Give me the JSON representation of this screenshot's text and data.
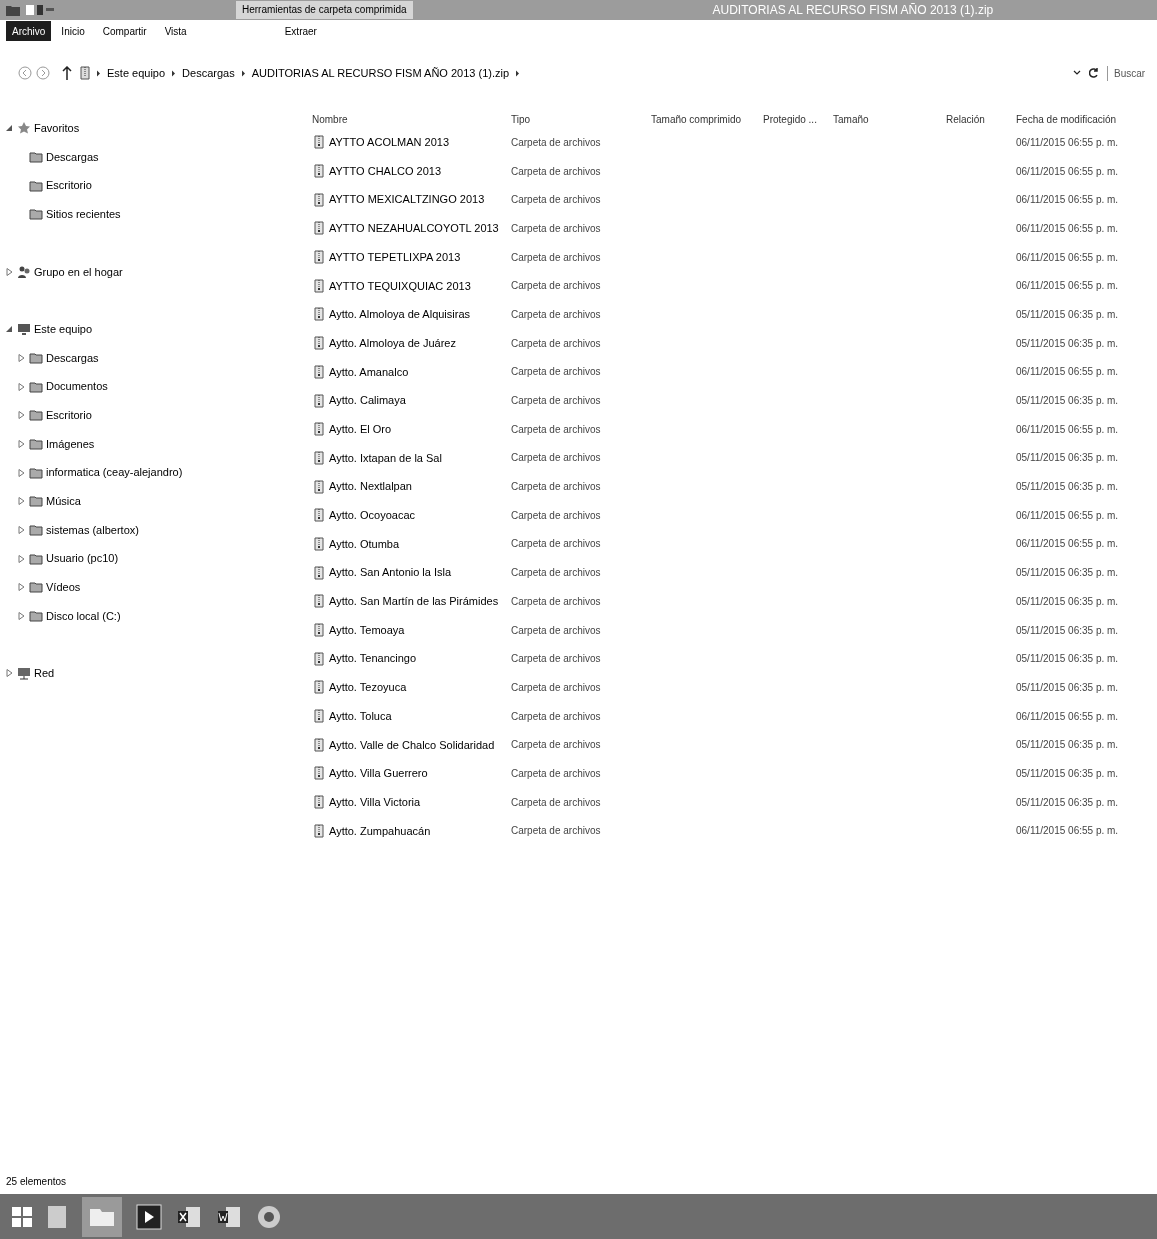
{
  "window": {
    "title": "AUDITORIAS AL RECURSO FISM AÑO 2013 (1).zip",
    "context_tab": "Herramientas de carpeta comprimida"
  },
  "ribbon_tabs": [
    {
      "label": "Archivo",
      "selected": true
    },
    {
      "label": "Inicio",
      "selected": false
    },
    {
      "label": "Compartir",
      "selected": false
    },
    {
      "label": "Vista",
      "selected": false
    },
    {
      "label": "Extraer",
      "selected": false
    }
  ],
  "address_bar": {
    "breadcrumbs": [
      "Este equipo",
      "Descargas",
      "AUDITORIAS AL RECURSO FISM AÑO 2013 (1).zip"
    ],
    "search_placeholder": "Buscar"
  },
  "sidebar": {
    "items": [
      {
        "label": "Favoritos",
        "expanded": true,
        "children": [
          {
            "label": "Descargas"
          },
          {
            "label": "Escritorio"
          },
          {
            "label": "Sitios recientes"
          }
        ]
      },
      {
        "label": "Grupo en el hogar",
        "expanded": false
      },
      {
        "label": "Este equipo",
        "expanded": true,
        "children": [
          {
            "label": "Descargas",
            "expanded": false
          },
          {
            "label": "Documentos",
            "expanded": false
          },
          {
            "label": "Escritorio",
            "expanded": false
          },
          {
            "label": "Imágenes",
            "expanded": false
          },
          {
            "label": "informatica (ceay-alejandro)",
            "expanded": false
          },
          {
            "label": "Música",
            "expanded": false
          },
          {
            "label": "sistemas (albertox)",
            "expanded": false
          },
          {
            "label": "Usuario (pc10)",
            "expanded": false
          },
          {
            "label": "Vídeos",
            "expanded": false
          },
          {
            "label": "Disco local (C:)",
            "expanded": false
          }
        ]
      },
      {
        "label": "Red",
        "expanded": false
      }
    ]
  },
  "table": {
    "columns": [
      "Nombre",
      "Tipo",
      "Tamaño comprimido",
      "Protegido ...",
      "Tamaño",
      "Relación",
      "Fecha de modificación"
    ],
    "rows": [
      {
        "name": "AYTTO ACOLMAN 2013",
        "type": "Carpeta de archivos",
        "modified": "06/11/2015 06:55 p. m."
      },
      {
        "name": "AYTTO CHALCO 2013",
        "type": "Carpeta de archivos",
        "modified": "06/11/2015 06:55 p. m."
      },
      {
        "name": "AYTTO MEXICALTZINGO 2013",
        "type": "Carpeta de archivos",
        "modified": "06/11/2015 06:55 p. m."
      },
      {
        "name": "AYTTO NEZAHUALCOYOTL 2013",
        "type": "Carpeta de archivos",
        "modified": "06/11/2015 06:55 p. m."
      },
      {
        "name": "AYTTO TEPETLIXPA 2013",
        "type": "Carpeta de archivos",
        "modified": "06/11/2015 06:55 p. m."
      },
      {
        "name": "AYTTO TEQUIXQUIAC 2013",
        "type": "Carpeta de archivos",
        "modified": "06/11/2015 06:55 p. m."
      },
      {
        "name": "Aytto. Almoloya de Alquisiras",
        "type": "Carpeta de archivos",
        "modified": "05/11/2015 06:35 p. m."
      },
      {
        "name": "Aytto. Almoloya de Juárez",
        "type": "Carpeta de archivos",
        "modified": "05/11/2015 06:35 p. m."
      },
      {
        "name": "Aytto. Amanalco",
        "type": "Carpeta de archivos",
        "modified": "06/11/2015 06:55 p. m."
      },
      {
        "name": "Aytto. Calimaya",
        "type": "Carpeta de archivos",
        "modified": "05/11/2015 06:35 p. m."
      },
      {
        "name": "Aytto. El Oro",
        "type": "Carpeta de archivos",
        "modified": "06/11/2015 06:55 p. m."
      },
      {
        "name": "Aytto. Ixtapan de la Sal",
        "type": "Carpeta de archivos",
        "modified": "05/11/2015 06:35 p. m."
      },
      {
        "name": "Aytto. Nextlalpan",
        "type": "Carpeta de archivos",
        "modified": "05/11/2015 06:35 p. m."
      },
      {
        "name": "Aytto. Ocoyoacac",
        "type": "Carpeta de archivos",
        "modified": "06/11/2015 06:55 p. m."
      },
      {
        "name": "Aytto. Otumba",
        "type": "Carpeta de archivos",
        "modified": "06/11/2015 06:55 p. m."
      },
      {
        "name": "Aytto. San Antonio la Isla",
        "type": "Carpeta de archivos",
        "modified": "05/11/2015 06:35 p. m."
      },
      {
        "name": "Aytto. San Martín de las Pirámides",
        "type": "Carpeta de archivos",
        "modified": "05/11/2015 06:35 p. m."
      },
      {
        "name": "Aytto. Temoaya",
        "type": "Carpeta de archivos",
        "modified": "05/11/2015 06:35 p. m."
      },
      {
        "name": "Aytto. Tenancingo",
        "type": "Carpeta de archivos",
        "modified": "05/11/2015 06:35 p. m."
      },
      {
        "name": "Aytto. Tezoyuca",
        "type": "Carpeta de archivos",
        "modified": "05/11/2015 06:35 p. m."
      },
      {
        "name": "Aytto. Toluca",
        "type": "Carpeta de archivos",
        "modified": "06/11/2015 06:55 p. m."
      },
      {
        "name": "Aytto. Valle de Chalco Solidaridad",
        "type": "Carpeta de archivos",
        "modified": "05/11/2015 06:35 p. m."
      },
      {
        "name": "Aytto. Villa Guerrero",
        "type": "Carpeta de archivos",
        "modified": "05/11/2015 06:35 p. m."
      },
      {
        "name": "Aytto. Villa Victoria",
        "type": "Carpeta de archivos",
        "modified": "05/11/2015 06:35 p. m."
      },
      {
        "name": "Aytto. Zumpahuacán",
        "type": "Carpeta de archivos",
        "modified": "06/11/2015 06:55 p. m."
      }
    ]
  },
  "status_bar": {
    "count": "25 elementos"
  }
}
